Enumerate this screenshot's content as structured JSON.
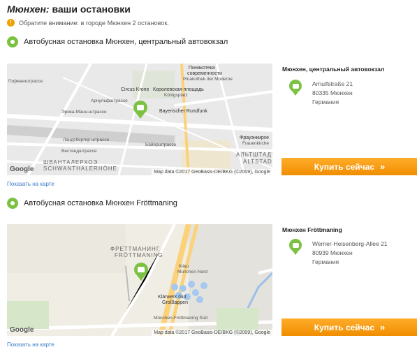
{
  "title": {
    "city": "Мюнхен:",
    "rest": " ваши остановки"
  },
  "notice": "Обратите внимание: в городе Мюнхен 2 остановок.",
  "stops": [
    {
      "name": "Автобусная остановка Мюнхен, центральный автовокзал",
      "info_title": "Мюнхен, центральный автовокзал",
      "address": [
        "Arnulfstraße 21",
        "80335 Мюнхен",
        "Германия"
      ],
      "buy_label": "Купить сейчас",
      "show_map": "Показать на карте",
      "map": {
        "copyright": "Map data ©2017 GeoBasis-DE/BKG (©2009), Google",
        "labels": [
          "Пинакотека",
          "современности",
          "Pinakothek der Moderne",
          "Circus Krone",
          "Королевская площадь",
          "Königsplatz",
          "Bayerischer Rundfunk",
          "Арнульфштрассе",
          "Эрика-Манн-штрассе",
          "Ландсбергер штрассе",
          "Вестендштрассе",
          "Байерштрассе",
          "Фрауэнкирхе",
          "Frauenkirche",
          "ШВАНТАЛЕРХОЭ",
          "SCHWANTHALERHÖHE",
          "АЛЬТШТАДТ",
          "ALTSTADT",
          "Гофманштрассе"
        ]
      }
    },
    {
      "name": "Автобусная остановка Мюнхен Fröttmaning",
      "info_title": "Мюнхен Fröttmaning",
      "address": [
        "Werner-Heisenberg-Allee 21",
        "80939 Мюнхен",
        "Германия"
      ],
      "buy_label": "Купить сейчас",
      "show_map": "Показать на карте",
      "map": {
        "copyright": "Map data ©2017 GeoBasis-DE/BKG (©2009), Google",
        "labels": [
          "ФРЕТТМАНИНГ",
          "FRÖTTMANING",
          "Klärwerk Gut",
          "Großlappen",
          "Кläш",
          "München-Nord",
          "München-Fröttmaning Süd"
        ]
      }
    }
  ],
  "google": "Google",
  "colors": {
    "accent": "#f49b10",
    "pin": "#7cc242",
    "link": "#3a7bc8"
  }
}
